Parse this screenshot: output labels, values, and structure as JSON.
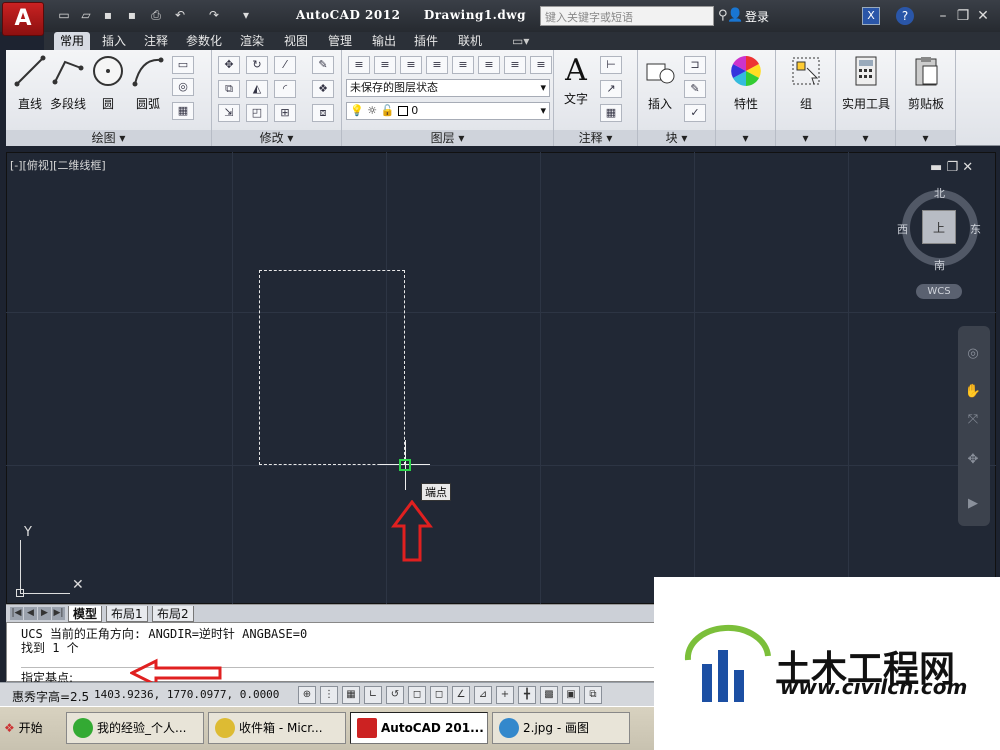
{
  "titlebar": {
    "app_name": "AutoCAD 2012",
    "doc_name": "Drawing1.dwg",
    "search_placeholder": "键入关键字或短语",
    "login": "登录"
  },
  "tabs": [
    {
      "label": "常用",
      "active": true
    },
    {
      "label": "插入"
    },
    {
      "label": "注释"
    },
    {
      "label": "参数化"
    },
    {
      "label": "渲染"
    },
    {
      "label": "视图"
    },
    {
      "label": "管理"
    },
    {
      "label": "输出"
    },
    {
      "label": "插件"
    },
    {
      "label": "联机"
    }
  ],
  "ribbon": {
    "draw": {
      "title": "绘图 ▾",
      "line": "直线",
      "polyline": "多段线",
      "circle": "圆",
      "arc": "圆弧"
    },
    "modify": {
      "title": "修改 ▾"
    },
    "layers": {
      "title": "图层 ▾",
      "state_combo": "未保存的图层状态",
      "layer_combo": "0"
    },
    "annotation": {
      "title": "注释 ▾",
      "text": "文字"
    },
    "block": {
      "title": "块 ▾",
      "insert": "插入"
    },
    "properties": "特性",
    "groups": "组",
    "utilities": "实用工具",
    "clipboard": "剪贴板"
  },
  "viewport": {
    "label": "[-][俯视][二维线框]",
    "tooltip": "端点",
    "compass": {
      "north": "北",
      "south": "南",
      "east": "东",
      "west": "西",
      "cube": "上"
    },
    "wcs": "WCS"
  },
  "layout_tabs": [
    "模型",
    "布局1",
    "布局2"
  ],
  "command": {
    "line1": "UCS 当前的正角方向:  ANGDIR=逆时针  ANGBASE=0",
    "line2": "找到 1 个",
    "prompt": "指定基点:"
  },
  "status": {
    "font_height": "惠秀字高=2.5",
    "coords": "1403.9236, 1770.0977, 0.0000"
  },
  "taskbar": {
    "start": "开始",
    "tasks": [
      {
        "label": "我的经验_个人..."
      },
      {
        "label": "收件箱 - Micr..."
      },
      {
        "label": "AutoCAD 201...",
        "active": true
      },
      {
        "label": "2.jpg - 画图"
      }
    ]
  },
  "watermark": {
    "brand": "土木工程网",
    "url": "www.civilcn.com"
  },
  "colors": {
    "canvas": "#212835",
    "snap": "#2bd44a",
    "arrow": "#e02020",
    "app_button": "#c92222"
  }
}
